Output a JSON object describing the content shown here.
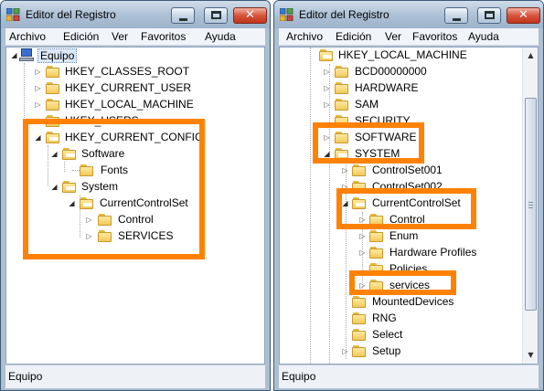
{
  "left": {
    "title": "Editor del Registro",
    "menu": [
      "Archivo",
      "Edición",
      "Ver",
      "Favoritos",
      "Ayuda"
    ],
    "status": "Equipo",
    "root_label": "Equipo",
    "tree": [
      {
        "label": "HKEY_CLASSES_ROOT"
      },
      {
        "label": "HKEY_CURRENT_USER"
      },
      {
        "label": "HKEY_LOCAL_MACHINE"
      },
      {
        "label": "HKEY_USERS"
      },
      {
        "label": "HKEY_CURRENT_CONFIG"
      },
      {
        "label": "Software"
      },
      {
        "label": "Fonts"
      },
      {
        "label": "System"
      },
      {
        "label": "CurrentControlSet"
      },
      {
        "label": "Control"
      },
      {
        "label": "SERVICES"
      }
    ]
  },
  "right": {
    "title": "Editor del Registro",
    "menu": [
      "Archivo",
      "Edición",
      "Ver",
      "Favoritos",
      "Ayuda"
    ],
    "status": "Equipo",
    "tree": [
      {
        "label": "HKEY_LOCAL_MACHINE"
      },
      {
        "label": "BCD00000000"
      },
      {
        "label": "HARDWARE"
      },
      {
        "label": "SAM"
      },
      {
        "label": "SECURITY"
      },
      {
        "label": "SOFTWARE"
      },
      {
        "label": "SYSTEM"
      },
      {
        "label": "ControlSet001"
      },
      {
        "label": "ControlSet002"
      },
      {
        "label": "CurrentControlSet"
      },
      {
        "label": "Control"
      },
      {
        "label": "Enum"
      },
      {
        "label": "Hardware Profiles"
      },
      {
        "label": "Policies"
      },
      {
        "label": "services"
      },
      {
        "label": "MountedDevices"
      },
      {
        "label": "RNG"
      },
      {
        "label": "Select"
      },
      {
        "label": "Setup"
      }
    ]
  },
  "colors": {
    "highlight": "#ff8206",
    "titlebar": "#a9bdd3",
    "folder": "#f1c95a",
    "close_button": "#d6533b"
  },
  "icons": {
    "app": "registry-editor-icon",
    "root": "computer-icon",
    "node": "folder-icon",
    "expand": "triangle-right-icon",
    "collapse": "triangle-down-icon"
  }
}
